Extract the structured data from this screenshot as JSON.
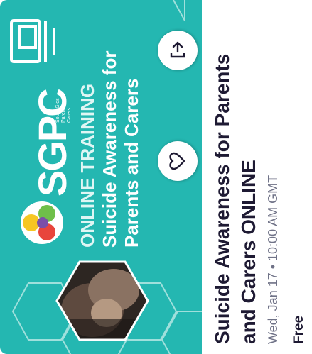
{
  "banner": {
    "logo_text": "SGPC",
    "logo_subtitle": "South Glos Parent Carers",
    "promo_prefix": "ONLINE TRAINING",
    "promo_title": "Suicide Awareness for Parents and Carers",
    "bg_color": "#24b7b1"
  },
  "actions": {
    "share_icon": "share-icon",
    "like_icon": "heart-icon"
  },
  "event": {
    "title": "Suicide Awareness for Parents and Carers ONLINE",
    "date": "Wed, Jan 17 • 10:00 AM GMT",
    "price": "Free"
  }
}
